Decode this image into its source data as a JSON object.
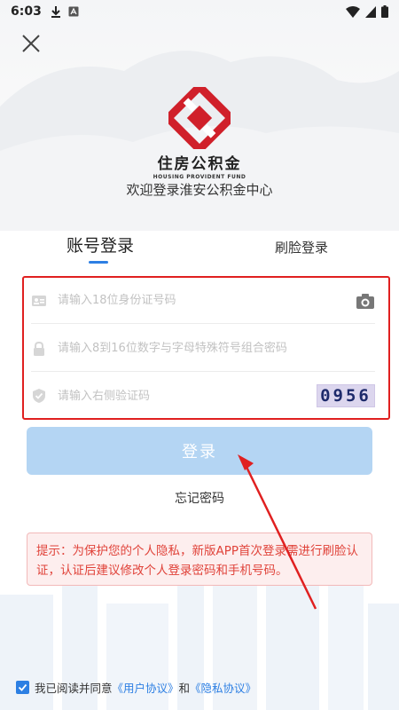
{
  "status_bar": {
    "time": "6:03"
  },
  "logo": {
    "title_cn": "住房公积金",
    "title_en": "HOUSING PROVIDENT FUND"
  },
  "welcome_text": "欢迎登录淮安公积金中心",
  "tabs": {
    "account": "账号登录",
    "face": "刷脸登录"
  },
  "form": {
    "id_placeholder": "请输入18位身份证号码",
    "password_placeholder": "请输入8到16位数字与字母特殊符号组合密码",
    "captcha_placeholder": "请输入右侧验证码",
    "captcha_text": "0956"
  },
  "login_button": "登录",
  "forgot_password": "忘记密码",
  "notice_text": "提示：为保护您的个人隐私，新版APP首次登录需进行刷脸认证，认证后建议修改个人登录密码和手机号码。",
  "agreement": {
    "prefix": "我已阅读并同意",
    "user_agreement": "《用户协议》",
    "conjunction": "和",
    "privacy_agreement": "《隐私协议》"
  },
  "colors": {
    "accent": "#2d7fe3",
    "login_button_bg": "#b4d5f3",
    "notice_text": "#e0433a",
    "annotation_red": "#e02020",
    "logo_red": "#d0202a"
  }
}
